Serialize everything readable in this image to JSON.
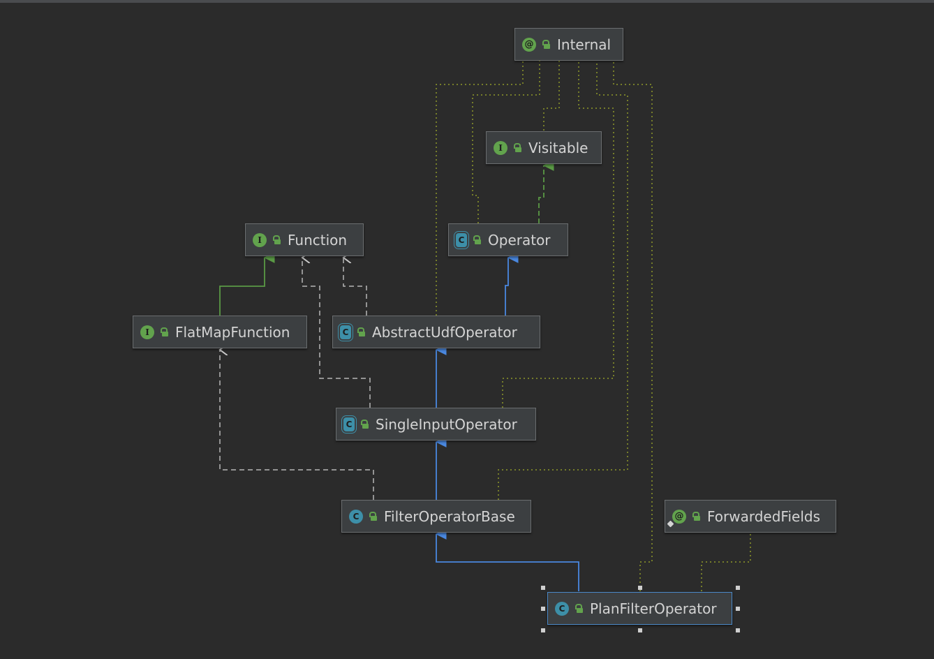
{
  "nodes": {
    "internal": {
      "label": "Internal",
      "kind": "@"
    },
    "visitable": {
      "label": "Visitable",
      "kind": "I"
    },
    "function": {
      "label": "Function",
      "kind": "I"
    },
    "operator": {
      "label": "Operator",
      "kind": "C"
    },
    "flatmap": {
      "label": "FlatMapFunction",
      "kind": "I"
    },
    "abstractudf": {
      "label": "AbstractUdfOperator",
      "kind": "C"
    },
    "singleinput": {
      "label": "SingleInputOperator",
      "kind": "C"
    },
    "filterbase": {
      "label": "FilterOperatorBase",
      "kind": "C"
    },
    "forwarded": {
      "label": "ForwardedFields",
      "kind": "@"
    },
    "planfilter": {
      "label": "PlanFilterOperator",
      "kind": "C"
    }
  },
  "colors": {
    "extends_class": "#4a88e0",
    "extends_interface": "#5a9a45",
    "implements": "#b8b8b8",
    "annotation": "#8f9a2a"
  }
}
